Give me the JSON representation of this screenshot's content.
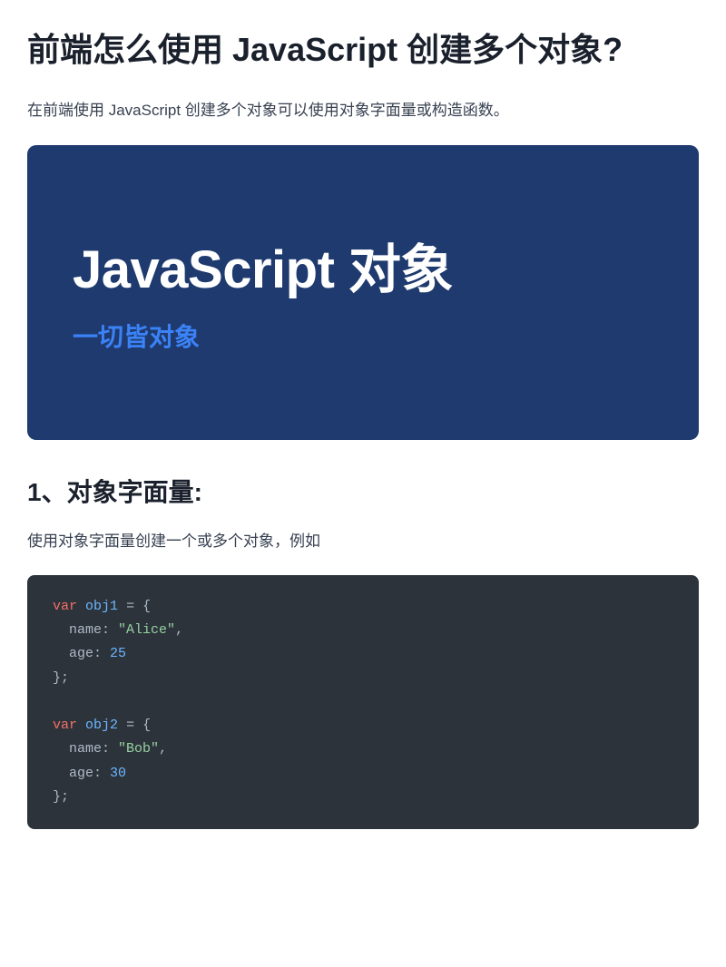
{
  "title": "前端怎么使用 JavaScript 创建多个对象?",
  "intro": "在前端使用 JavaScript 创建多个对象可以使用对象字面量或构造函数。",
  "hero": {
    "title": "JavaScript 对象",
    "subtitle": "一切皆对象"
  },
  "section1": {
    "heading": "1、对象字面量:",
    "description": "使用对象字面量创建一个或多个对象，例如",
    "code": {
      "obj1": {
        "var_kw": "var",
        "name": "obj1",
        "prop1_key": "name",
        "prop1_val": "\"Alice\"",
        "prop2_key": "age",
        "prop2_val": "25"
      },
      "obj2": {
        "var_kw": "var",
        "name": "obj2",
        "prop1_key": "name",
        "prop1_val": "\"Bob\"",
        "prop2_key": "age",
        "prop2_val": "30"
      }
    }
  }
}
